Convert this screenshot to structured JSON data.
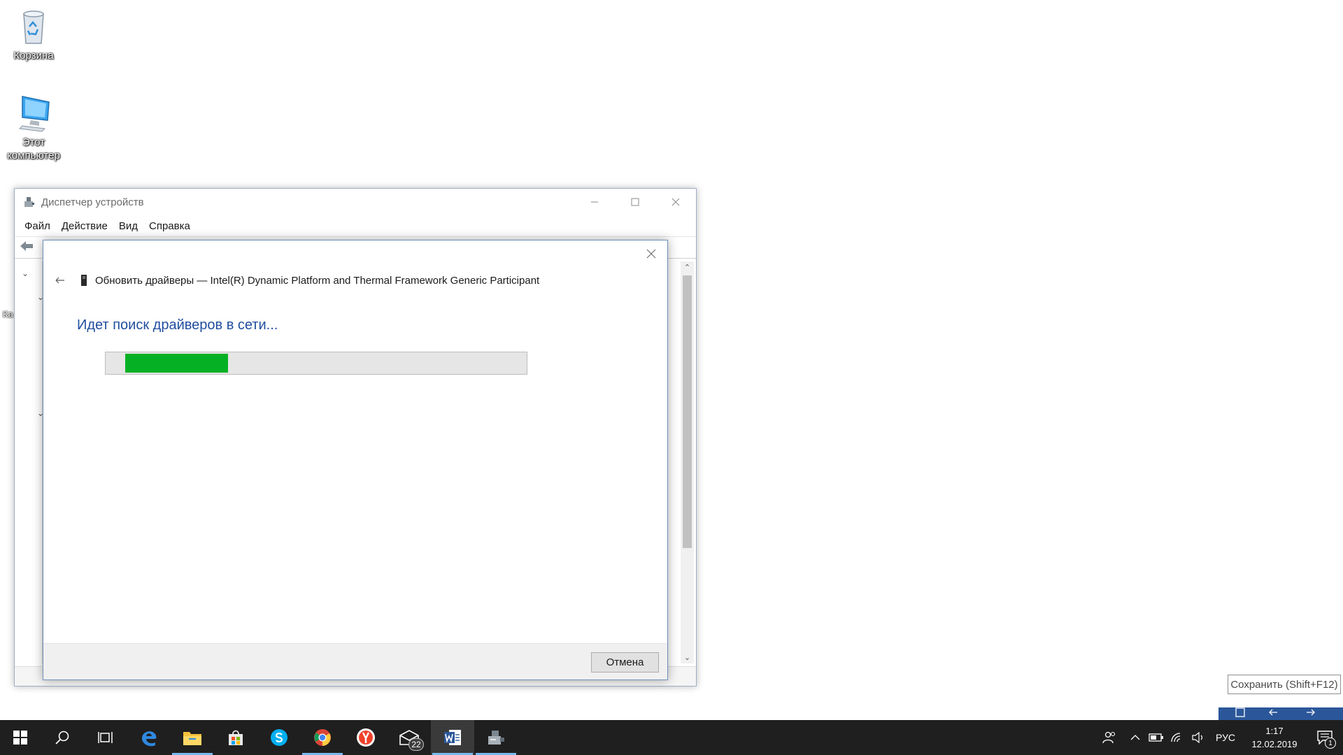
{
  "desktop": {
    "icons": [
      {
        "label": "Корзина",
        "icon": "recycle-bin-icon"
      },
      {
        "label": "Этот компьютер",
        "icon": "this-pc-icon"
      }
    ],
    "edge_label": "Ка"
  },
  "device_manager": {
    "title": "Диспетчер устройств",
    "menu": [
      "Файл",
      "Действие",
      "Вид",
      "Справка"
    ]
  },
  "dialog": {
    "header": "Обновить драйверы — Intel(R) Dynamic Platform and Thermal Framework Generic Participant",
    "heading": "Идет поиск драйверов в сети...",
    "progress_fraction": 0.27,
    "cancel_label": "Отмена"
  },
  "tooltip": "Сохранить (Shift+F12)",
  "taskbar": {
    "apps": [
      "start",
      "search",
      "task-view",
      "edge",
      "file-explorer",
      "store",
      "skype",
      "chrome",
      "yandex",
      "mail",
      "word",
      "device-manager"
    ],
    "mail_badge": "22",
    "language": "РУС",
    "time": "1:17",
    "date": "12.02.2019",
    "notifications": "1"
  },
  "colors": {
    "accent_text": "#1f4e9e",
    "progress_fill": "#06b025",
    "taskbar": "#1f1f1f"
  }
}
